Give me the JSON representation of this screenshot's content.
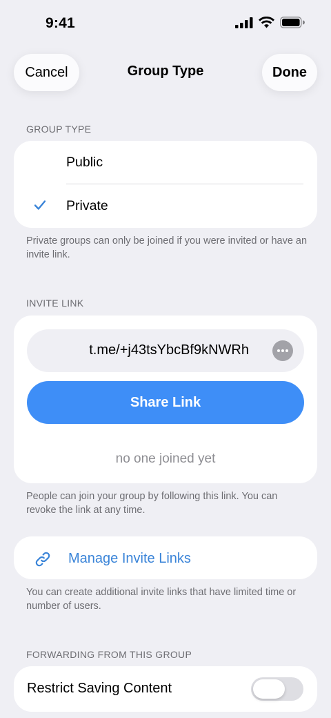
{
  "status_bar": {
    "time": "9:41",
    "icons": [
      "signal-icon",
      "wifi-icon",
      "battery-icon"
    ]
  },
  "nav": {
    "cancel_label": "Cancel",
    "title": "Group Type",
    "done_label": "Done"
  },
  "group_type": {
    "header": "GROUP TYPE",
    "options": [
      {
        "label": "Public",
        "selected": false
      },
      {
        "label": "Private",
        "selected": true
      }
    ],
    "footnote": "Private groups can only be joined if you were invited or have an invite link."
  },
  "invite_link": {
    "header": "INVITE LINK",
    "link": "t.me/+j43tsYbcBf9kNWRh",
    "share_label": "Share Link",
    "joined_status": "no one joined yet",
    "footnote": "People can join your group by following this link. You can revoke the link at any time."
  },
  "manage": {
    "label": "Manage Invite Links",
    "icon": "link-icon",
    "footnote": "You can create additional invite links that have limited time or number of users."
  },
  "forwarding": {
    "header": "FORWARDING FROM THIS GROUP",
    "restrict_label": "Restrict Saving Content",
    "restrict_enabled": false
  },
  "colors": {
    "accent": "#3e8ef7",
    "link_text": "#3a84d8",
    "background": "#efeff4",
    "secondary_text": "#6d6d72"
  }
}
